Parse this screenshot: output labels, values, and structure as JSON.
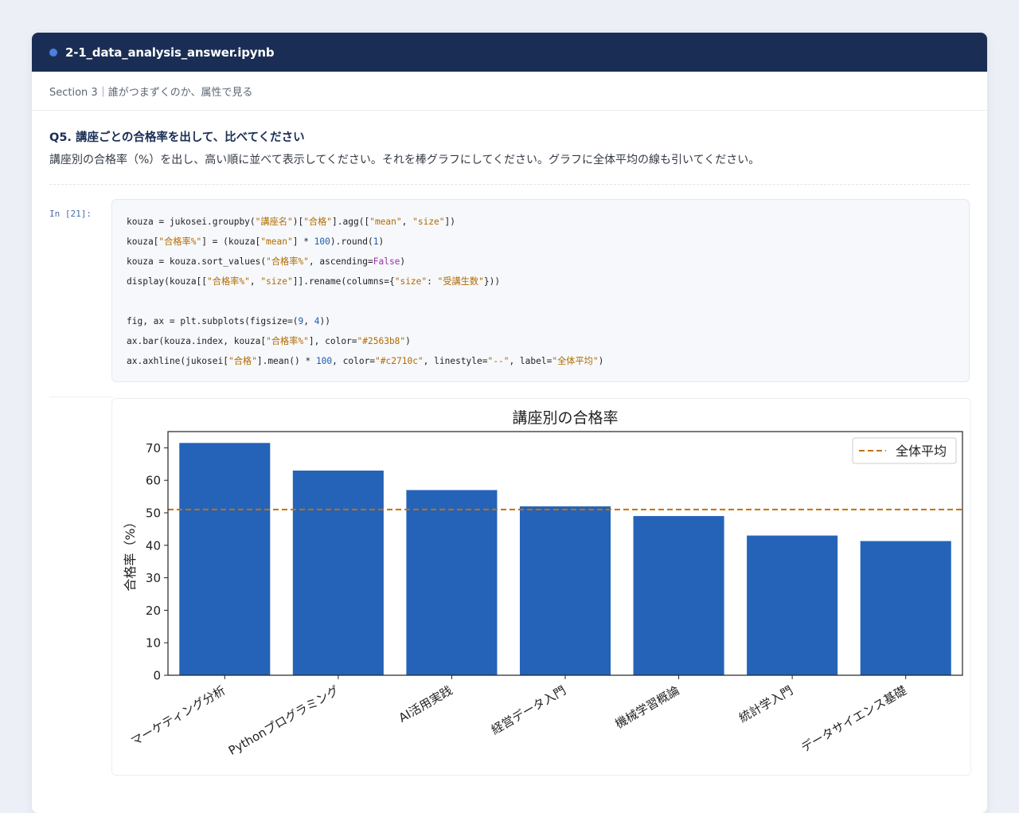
{
  "window": {
    "title": "2-1_data_analysis_answer.ipynb"
  },
  "section": {
    "label": "Section 3｜誰がつまずくのか、属性で見る"
  },
  "question": {
    "title": "Q5. 講座ごとの合格率を出して、比べてください",
    "description": "講座別の合格率（%）を出し、高い順に並べて表示してください。それを棒グラフにしてください。グラフに全体平均の線も引いてください。"
  },
  "cell": {
    "prompt": "In [21]:",
    "code_lines": [
      [
        [
          "kouza = jukosei.groupby(",
          "plain"
        ],
        [
          "\"講座名\"",
          "str"
        ],
        [
          ")[",
          "plain"
        ],
        [
          "\"合格\"",
          "str"
        ],
        [
          "].agg([",
          "plain"
        ],
        [
          "\"mean\"",
          "str"
        ],
        [
          ", ",
          "plain"
        ],
        [
          "\"size\"",
          "str"
        ],
        [
          "])",
          "plain"
        ]
      ],
      [
        [
          "kouza[",
          "plain"
        ],
        [
          "\"合格率%\"",
          "str"
        ],
        [
          "] = (kouza[",
          "plain"
        ],
        [
          "\"mean\"",
          "str"
        ],
        [
          "] * ",
          "plain"
        ],
        [
          "100",
          "num"
        ],
        [
          ").round(",
          "plain"
        ],
        [
          "1",
          "num"
        ],
        [
          ")",
          "plain"
        ]
      ],
      [
        [
          "kouza = kouza.sort_values(",
          "plain"
        ],
        [
          "\"合格率%\"",
          "str"
        ],
        [
          ", ascending=",
          "plain"
        ],
        [
          "False",
          "kw"
        ],
        [
          ")",
          "plain"
        ]
      ],
      [
        [
          "display(kouza[[",
          "plain"
        ],
        [
          "\"合格率%\"",
          "str"
        ],
        [
          ", ",
          "plain"
        ],
        [
          "\"size\"",
          "str"
        ],
        [
          "]].rename(columns={",
          "plain"
        ],
        [
          "\"size\"",
          "str"
        ],
        [
          ": ",
          "plain"
        ],
        [
          "\"受講生数\"",
          "str"
        ],
        [
          "}))",
          "plain"
        ]
      ],
      [],
      [
        [
          "fig, ax = plt.subplots(figsize=(",
          "plain"
        ],
        [
          "9",
          "num"
        ],
        [
          ", ",
          "plain"
        ],
        [
          "4",
          "num"
        ],
        [
          "))",
          "plain"
        ]
      ],
      [
        [
          "ax.bar(kouza.index, kouza[",
          "plain"
        ],
        [
          "\"合格率%\"",
          "str"
        ],
        [
          "], color=",
          "plain"
        ],
        [
          "\"#2563b8\"",
          "str"
        ],
        [
          ")",
          "plain"
        ]
      ],
      [
        [
          "ax.axhline(jukosei[",
          "plain"
        ],
        [
          "\"合格\"",
          "str"
        ],
        [
          "].mean() * ",
          "plain"
        ],
        [
          "100",
          "num"
        ],
        [
          ", color=",
          "plain"
        ],
        [
          "\"#c2710c\"",
          "str"
        ],
        [
          ", linestyle=",
          "plain"
        ],
        [
          "\"--\"",
          "str"
        ],
        [
          ", label=",
          "plain"
        ],
        [
          "\"全体平均\"",
          "str"
        ],
        [
          ")",
          "plain"
        ]
      ]
    ]
  },
  "chart_data": {
    "type": "bar",
    "title": "講座別の合格率",
    "xlabel": "",
    "ylabel": "合格率（%）",
    "categories": [
      "マーケティング分析",
      "Pythonプログラミング",
      "AI活用実践",
      "経営データ入門",
      "機械学習概論",
      "統計学入門",
      "データサイエンス基礎"
    ],
    "values": [
      71.5,
      63.0,
      57.0,
      52.0,
      49.0,
      43.0,
      41.3
    ],
    "bar_color": "#2563b8",
    "ylim": [
      0,
      75
    ],
    "yticks": [
      0,
      10,
      20,
      30,
      40,
      50,
      60,
      70
    ],
    "reference_line": {
      "value": 51,
      "label": "全体平均",
      "color": "#c2710c",
      "style": "dashed"
    },
    "legend_position": "top-right",
    "grid": false
  }
}
